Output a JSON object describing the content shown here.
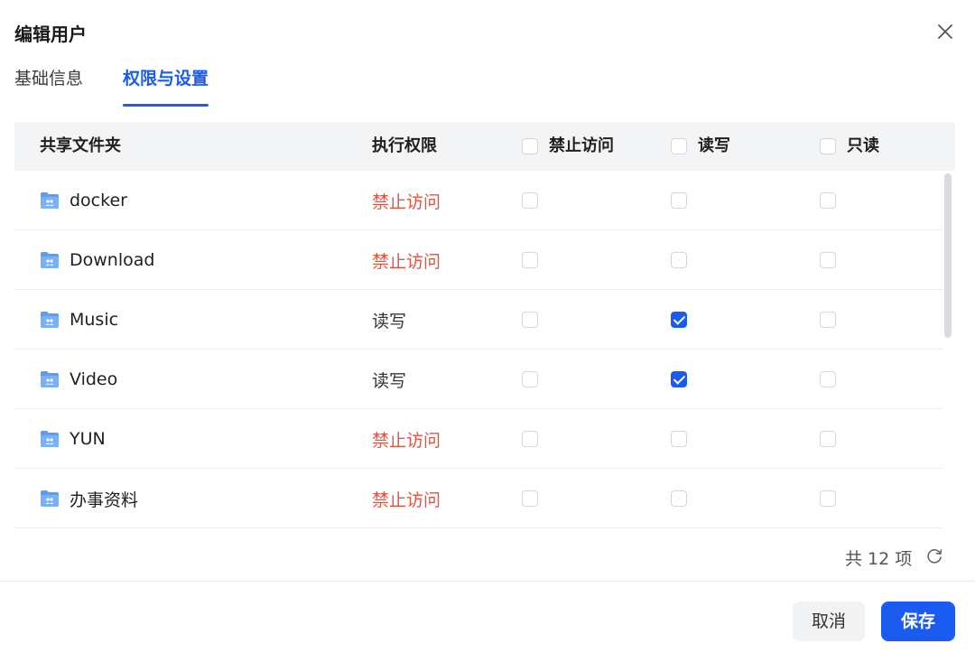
{
  "dialog": {
    "title": "编辑用户"
  },
  "tabs": [
    {
      "label": "基础信息",
      "active": false
    },
    {
      "label": "权限与设置",
      "active": true
    }
  ],
  "table": {
    "headers": {
      "folder": "共享文件夹",
      "permission": "执行权限",
      "deny": "禁止访问",
      "read_write": "读写",
      "read_only": "只读"
    },
    "rows": [
      {
        "name": "docker",
        "permission": "禁止访问",
        "status": "deny",
        "deny": false,
        "read_write": false,
        "read_only": false
      },
      {
        "name": "Download",
        "permission": "禁止访问",
        "status": "deny",
        "deny": false,
        "read_write": false,
        "read_only": false
      },
      {
        "name": "Music",
        "permission": "读写",
        "status": "rw",
        "deny": false,
        "read_write": true,
        "read_only": false
      },
      {
        "name": "Video",
        "permission": "读写",
        "status": "rw",
        "deny": false,
        "read_write": true,
        "read_only": false
      },
      {
        "name": "YUN",
        "permission": "禁止访问",
        "status": "deny",
        "deny": false,
        "read_write": false,
        "read_only": false
      },
      {
        "name": "办事资料",
        "permission": "禁止访问",
        "status": "deny",
        "deny": false,
        "read_write": false,
        "read_only": false
      }
    ]
  },
  "pagination": {
    "total_label": "共 12 项"
  },
  "footer": {
    "cancel_label": "取消",
    "save_label": "保存"
  },
  "colors": {
    "accent": "#1a5cf0",
    "deny": "#e5533d",
    "header_bg": "#f3f4f6",
    "folder_icon": "#5b9cf5"
  }
}
